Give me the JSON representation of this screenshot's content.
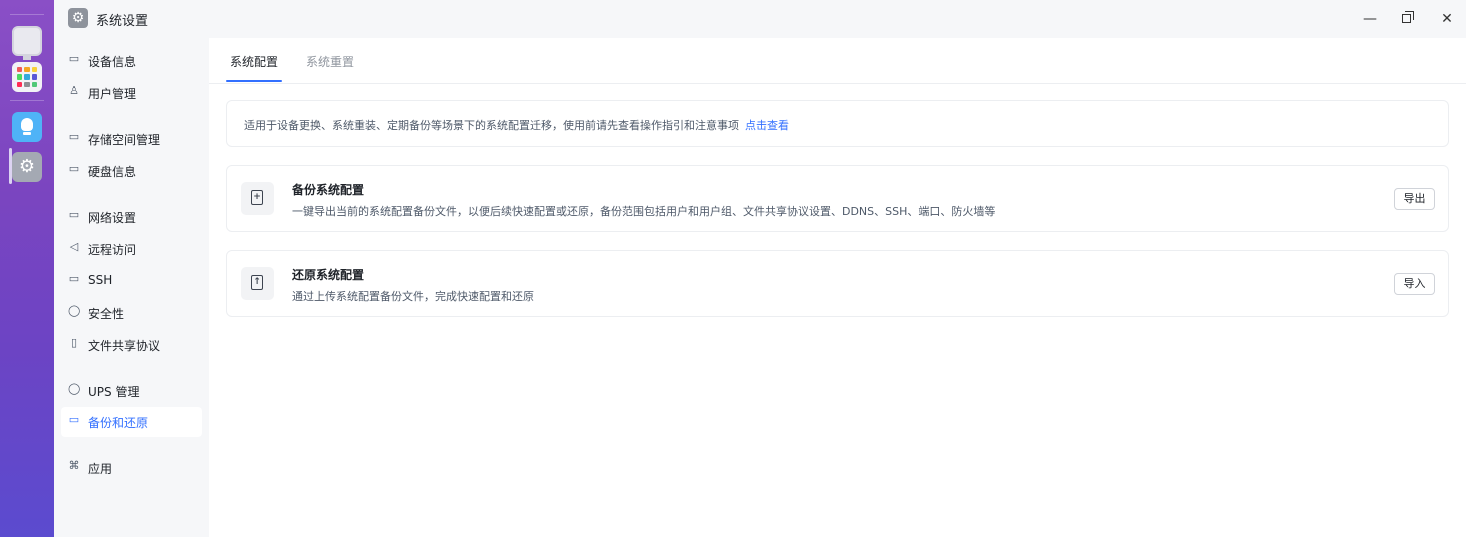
{
  "window": {
    "title": "系统设置",
    "app_icon_glyph": "⚙"
  },
  "dock": {
    "apps": [
      "monitor-icon",
      "app-grid-icon",
      "bulb-icon",
      "settings-icon"
    ],
    "settings_glyph": "⚙",
    "grid_colors": [
      "#f05a5a",
      "#f5a623",
      "#f7d13b",
      "#4cd964",
      "#34aadc",
      "#5856d6",
      "#ff2d55",
      "#8e8e93",
      "#50c878"
    ]
  },
  "sidebar": {
    "items": [
      {
        "label": "设备信息",
        "icon": "device-icon",
        "glyph": "▭"
      },
      {
        "label": "用户管理",
        "icon": "user-icon",
        "glyph": "♙"
      },
      {
        "label": "存储空间管理",
        "icon": "storage-icon",
        "glyph": "▭"
      },
      {
        "label": "硬盘信息",
        "icon": "disk-icon",
        "glyph": "▭"
      },
      {
        "label": "网络设置",
        "icon": "network-icon",
        "glyph": "▭"
      },
      {
        "label": "远程访问",
        "icon": "send-icon",
        "glyph": "◁"
      },
      {
        "label": "SSH",
        "icon": "terminal-icon",
        "glyph": "▭"
      },
      {
        "label": "安全性",
        "icon": "shield-check-icon",
        "glyph": "◯"
      },
      {
        "label": "文件共享协议",
        "icon": "file-icon",
        "glyph": "▯"
      },
      {
        "label": "UPS 管理",
        "icon": "shield-icon",
        "glyph": "◯"
      },
      {
        "label": "备份和还原",
        "icon": "backup-icon",
        "glyph": "▭"
      },
      {
        "label": "应用",
        "icon": "apps-icon",
        "glyph": "⌘"
      }
    ],
    "active_index": 10
  },
  "tabs": [
    {
      "label": "系统配置",
      "active": true
    },
    {
      "label": "系统重置",
      "active": false
    }
  ],
  "notice": {
    "text": "适用于设备更换、系统重装、定期备份等场景下的系统配置迁移，使用前请先查看操作指引和注意事项",
    "link": "点击查看"
  },
  "cards": [
    {
      "title": "备份系统配置",
      "desc": "一键导出当前的系统配置备份文件，以便后续快速配置或还原，备份范围包括用户和用户组、文件共享协议设置、DDNS、SSH、端口、防火墙等",
      "button": "导出",
      "icon": "file-export-icon",
      "glyph": "+"
    },
    {
      "title": "还原系统配置",
      "desc": "通过上传系统配置备份文件，完成快速配置和还原",
      "button": "导入",
      "icon": "file-import-icon",
      "glyph": "↑"
    }
  ],
  "colors": {
    "accent": "#3370ff",
    "dock_top": "#8a4fc6",
    "dock_bottom": "#5b4bcf"
  }
}
